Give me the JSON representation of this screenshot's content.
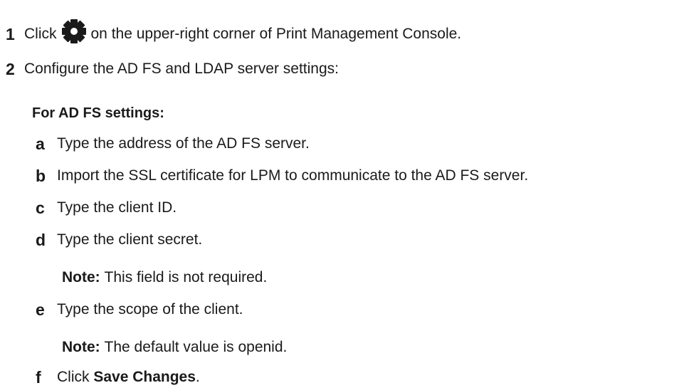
{
  "steps": [
    {
      "number": "1",
      "text_before_icon": "Click",
      "icon": "gear-icon",
      "text_after_icon": "on the upper-right corner of Print Management Console."
    },
    {
      "number": "2",
      "text": "Configure the AD FS and LDAP server settings:"
    }
  ],
  "adfs": {
    "heading": "For AD FS settings:",
    "items": [
      {
        "letter": "a",
        "text": "Type the address of the AD FS server."
      },
      {
        "letter": "b",
        "text": "Import the SSL certificate for LPM to communicate to the AD FS server."
      },
      {
        "letter": "c",
        "text": "Type the client ID."
      },
      {
        "letter": "d",
        "text": "Type the client secret.",
        "note_label": "Note:",
        "note_text": "This field is not required."
      },
      {
        "letter": "e",
        "text": "Type the scope of the client.",
        "note_label": "Note:",
        "note_text": "The default value is openid."
      },
      {
        "letter": "f",
        "text_before": "Click",
        "bold_text": "Save Changes",
        "text_after": "."
      }
    ]
  },
  "colors": {
    "text": "#1a1a1a",
    "icon": "#1a1a1a"
  }
}
